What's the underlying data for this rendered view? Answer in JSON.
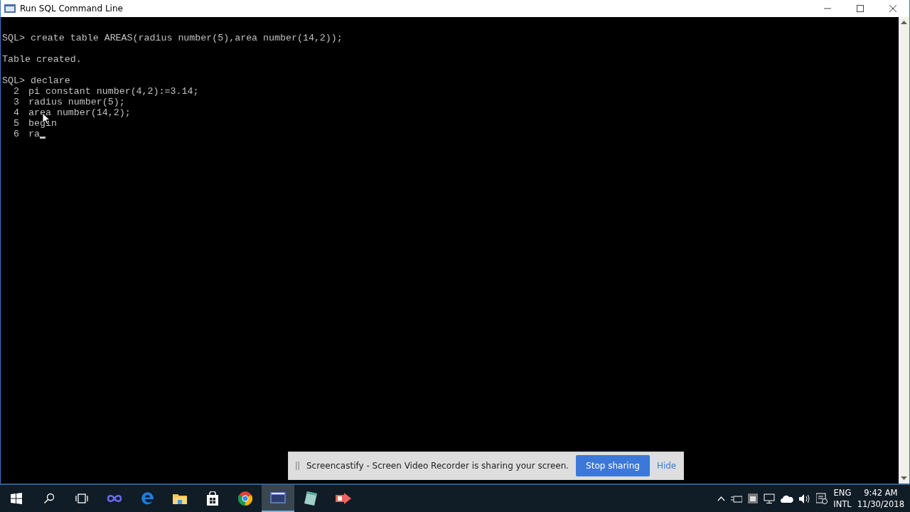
{
  "window": {
    "title": "Run SQL Command Line"
  },
  "console": {
    "lines": [
      {
        "kind": "blank"
      },
      {
        "kind": "prompt",
        "prefix": "SQL>",
        "text": "create table AREAS(radius number(5),area number(14,2));"
      },
      {
        "kind": "blank"
      },
      {
        "kind": "output",
        "text": "Table created."
      },
      {
        "kind": "blank"
      },
      {
        "kind": "prompt",
        "prefix": "SQL>",
        "text": "declare"
      },
      {
        "kind": "numbered",
        "prefix": "2",
        "text": "pi constant number(4,2):=3.14;"
      },
      {
        "kind": "numbered",
        "prefix": "3",
        "text": "radius number(5);"
      },
      {
        "kind": "numbered",
        "prefix": "4",
        "text": "area number(14,2);"
      },
      {
        "kind": "numbered",
        "prefix": "5",
        "text": "begin",
        "pointer": true
      },
      {
        "kind": "numbered",
        "prefix": "6",
        "text": "ra",
        "cursor": true
      }
    ]
  },
  "share_bar": {
    "message": "Screencastify - Screen Video Recorder is sharing your screen.",
    "buttons": [
      {
        "label": "Stop sharing",
        "kind": "primary"
      },
      {
        "label": "Hide",
        "kind": "link"
      }
    ]
  },
  "taskbar": {
    "apps": [
      {
        "kind": "start"
      },
      {
        "kind": "search"
      },
      {
        "kind": "taskview"
      },
      {
        "kind": "infinity"
      },
      {
        "kind": "edge"
      },
      {
        "kind": "explorer"
      },
      {
        "kind": "store"
      },
      {
        "kind": "chrome"
      },
      {
        "kind": "sql",
        "active": true
      },
      {
        "kind": "notepad"
      },
      {
        "kind": "recorder"
      }
    ],
    "tray": {
      "language": "ENG",
      "layout": "INTL",
      "time": "9:42 AM",
      "date": "11/30/2018"
    }
  }
}
